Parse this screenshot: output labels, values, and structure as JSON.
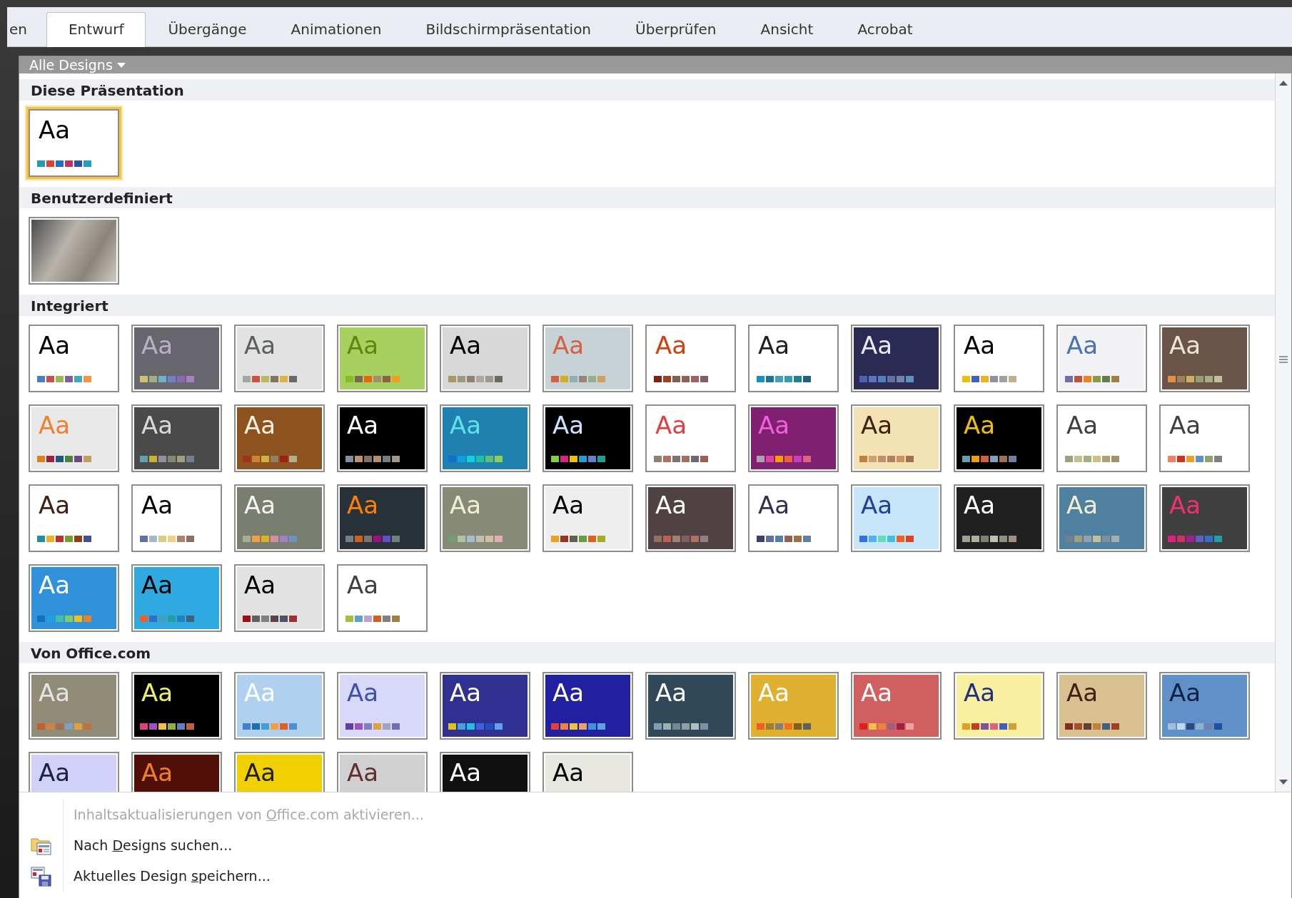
{
  "tabs": [
    {
      "label": "en",
      "selected": false
    },
    {
      "label": "Entwurf",
      "selected": true
    },
    {
      "label": "Übergänge",
      "selected": false
    },
    {
      "label": "Animationen",
      "selected": false
    },
    {
      "label": "Bildschirmpräsentation",
      "selected": false
    },
    {
      "label": "Überprüfen",
      "selected": false
    },
    {
      "label": "Ansicht",
      "selected": false
    },
    {
      "label": "Acrobat",
      "selected": false
    }
  ],
  "gallery": {
    "filter": "Alle Designs",
    "sections": [
      {
        "title": "Diese Präsentation",
        "thumbnails": [
          {
            "kind": "theme",
            "selected": true,
            "color": "#ffffff",
            "sample": {
              "label": "Aa",
              "color": "#000000"
            },
            "swatches": [
              {
                "color": "#1f9bb8"
              },
              {
                "color": "#e04030"
              },
              {
                "color": "#2070c0"
              },
              {
                "color": "#c03060"
              },
              {
                "color": "#3050a0"
              },
              {
                "color": "#20a0c0"
              }
            ]
          }
        ]
      },
      {
        "title": "Benutzerdefiniert",
        "thumbnails": [
          {
            "kind": "photo",
            "selected": false
          }
        ]
      },
      {
        "title": "Integriert",
        "thumbnails": [
          {
            "kind": "theme",
            "selected": false,
            "color": "#ffffff",
            "sample": {
              "label": "Aa",
              "color": "#000000"
            },
            "swatches": [
              {
                "color": "#4a7ec0"
              },
              {
                "color": "#c85050"
              },
              {
                "color": "#9ab850"
              },
              {
                "color": "#7e60a0"
              },
              {
                "color": "#40a8c4"
              },
              {
                "color": "#f69440"
              }
            ]
          },
          {
            "kind": "theme",
            "selected": false,
            "color": "#66666c",
            "sample": {
              "label": "Aa",
              "color": "#b8b0c8"
            },
            "swatches": [
              {
                "color": "#cfc070"
              },
              {
                "color": "#a0b080"
              },
              {
                "color": "#70b0c8"
              },
              {
                "color": "#7080c8"
              },
              {
                "color": "#8868b8"
              },
              {
                "color": "#a880c0"
              }
            ]
          },
          {
            "kind": "theme",
            "selected": false,
            "color": "#e2e2e2",
            "sample": {
              "label": "Aa",
              "color": "#5a6060"
            },
            "swatches": [
              {
                "color": "#a0a8a0"
              },
              {
                "color": "#d05040"
              },
              {
                "color": "#c0b860"
              },
              {
                "color": "#807858"
              },
              {
                "color": "#e0b040"
              },
              {
                "color": "#706868"
              }
            ]
          },
          {
            "kind": "theme",
            "selected": false,
            "color": "#a8d060",
            "sample": {
              "label": "Aa",
              "color": "#5c8a08"
            },
            "swatches": [
              {
                "color": "#80c020"
              },
              {
                "color": "#786850"
              },
              {
                "color": "#f06010"
              },
              {
                "color": "#a09070"
              },
              {
                "color": "#906040"
              },
              {
                "color": "#f0a020"
              }
            ]
          },
          {
            "kind": "theme",
            "selected": false,
            "color": "#d8d8d8",
            "sample": {
              "label": "Aa",
              "color": "#000000"
            },
            "swatches": [
              {
                "color": "#a89868"
              },
              {
                "color": "#a09880"
              },
              {
                "color": "#908070"
              },
              {
                "color": "#b0a898"
              },
              {
                "color": "#a09890"
              },
              {
                "color": "#706858"
              }
            ]
          },
          {
            "kind": "theme",
            "selected": false,
            "color": "#c6d2d6",
            "sample": {
              "label": "Aa",
              "color": "#d86040"
            },
            "swatches": [
              {
                "color": "#d06040"
              },
              {
                "color": "#d0b020"
              },
              {
                "color": "#90b0b0"
              },
              {
                "color": "#a08070"
              },
              {
                "color": "#90b090"
              },
              {
                "color": "#d0a060"
              }
            ]
          },
          {
            "kind": "theme",
            "selected": false,
            "color": "#ffffff",
            "sample": {
              "label": "Aa",
              "color": "#d04010"
            },
            "swatches": [
              {
                "color": "#802010"
              },
              {
                "color": "#a04020"
              },
              {
                "color": "#806050"
              },
              {
                "color": "#906050"
              },
              {
                "color": "#a06060"
              },
              {
                "color": "#806060"
              }
            ]
          },
          {
            "kind": "theme",
            "selected": false,
            "color": "#ffffff",
            "sample": {
              "label": "Aa",
              "color": "#202020"
            },
            "swatches": [
              {
                "color": "#1890c0"
              },
              {
                "color": "#2070a0"
              },
              {
                "color": "#40a0c0"
              },
              {
                "color": "#30a0b0"
              },
              {
                "color": "#208090"
              },
              {
                "color": "#206080"
              }
            ]
          },
          {
            "kind": "theme",
            "selected": false,
            "color": "#2a2a52",
            "sample": {
              "label": "Aa",
              "color": "#e8e8f8"
            },
            "swatches": [
              {
                "color": "#5060b0"
              },
              {
                "color": "#6070c0"
              },
              {
                "color": "#5080c0"
              },
              {
                "color": "#6070a0"
              },
              {
                "color": "#7080b0"
              },
              {
                "color": "#6090c0"
              }
            ]
          },
          {
            "kind": "theme",
            "selected": false,
            "color": "#ffffff",
            "sample": {
              "label": "Aa",
              "color": "#000000"
            },
            "swatches": [
              {
                "color": "#f0c000"
              },
              {
                "color": "#4060c0"
              },
              {
                "color": "#f0b020"
              },
              {
                "color": "#9090a0"
              },
              {
                "color": "#a0a0a0"
              },
              {
                "color": "#c0b090"
              }
            ]
          },
          {
            "kind": "theme",
            "selected": false,
            "color": "#f2f2f6",
            "sample": {
              "label": "Aa",
              "color": "#4a72b8"
            },
            "swatches": [
              {
                "color": "#7070a0"
              },
              {
                "color": "#c05040"
              },
              {
                "color": "#f08020"
              },
              {
                "color": "#80a040"
              },
              {
                "color": "#608050"
              },
              {
                "color": "#a08040"
              }
            ]
          },
          {
            "kind": "theme",
            "selected": false,
            "color": "#6a5448",
            "sample": {
              "label": "Aa",
              "color": "#ece4d4"
            },
            "swatches": [
              {
                "color": "#e09040"
              },
              {
                "color": "#a08060"
              },
              {
                "color": "#d0b060"
              },
              {
                "color": "#90a070"
              },
              {
                "color": "#a0b080"
              },
              {
                "color": "#c0c0a0"
              }
            ]
          },
          {
            "kind": "theme",
            "selected": false,
            "color": "#e8e8e8",
            "sample": {
              "label": "Aa",
              "color": "#f08030"
            },
            "swatches": [
              {
                "color": "#e08020"
              },
              {
                "color": "#a02040"
              },
              {
                "color": "#1a5a80"
              },
              {
                "color": "#4a8040"
              },
              {
                "color": "#704880"
              },
              {
                "color": "#c0a060"
              }
            ]
          },
          {
            "kind": "theme",
            "selected": false,
            "color": "#4a4a4a",
            "sample": {
              "label": "Aa",
              "color": "#d8d8d8"
            },
            "swatches": [
              {
                "color": "#60a0b0"
              },
              {
                "color": "#c8b030"
              },
              {
                "color": "#9090a0"
              },
              {
                "color": "#808870"
              },
              {
                "color": "#a0a080"
              },
              {
                "color": "#708090"
              }
            ]
          },
          {
            "kind": "theme",
            "selected": false,
            "color": "#8c5220",
            "sample": {
              "label": "Aa",
              "color": "#f8f0e0"
            },
            "swatches": [
              {
                "color": "#a03020"
              },
              {
                "color": "#d08030"
              },
              {
                "color": "#d0b040"
              },
              {
                "color": "#908060"
              },
              {
                "color": "#a02010"
              },
              {
                "color": "#b0b090"
              }
            ]
          },
          {
            "kind": "theme",
            "selected": false,
            "color": "#000000",
            "sample": {
              "label": "Aa",
              "color": "#ffffff"
            },
            "swatches": [
              {
                "color": "#8090a0"
              },
              {
                "color": "#c09070"
              },
              {
                "color": "#807068"
              },
              {
                "color": "#b09070"
              },
              {
                "color": "#708080"
              },
              {
                "color": "#a09880"
              }
            ]
          },
          {
            "kind": "theme",
            "selected": false,
            "color": "#2080b0",
            "sample": {
              "label": "Aa",
              "color": "#60e0e8"
            },
            "swatches": [
              {
                "color": "#1070d0"
              },
              {
                "color": "#10a0e0"
              },
              {
                "color": "#10d0e0"
              },
              {
                "color": "#20c0a0"
              },
              {
                "color": "#60c070"
              },
              {
                "color": "#90d050"
              }
            ]
          },
          {
            "kind": "theme",
            "selected": false,
            "color": "#000000",
            "sample": {
              "label": "Aa",
              "color": "#c8e4ff"
            },
            "swatches": [
              {
                "color": "#80d040"
              },
              {
                "color": "#e02080"
              },
              {
                "color": "#f0c000"
              },
              {
                "color": "#20a0d0"
              },
              {
                "color": "#6080d0"
              },
              {
                "color": "#20a090"
              }
            ]
          },
          {
            "kind": "theme",
            "selected": false,
            "color": "#ffffff",
            "sample": {
              "label": "Aa",
              "color": "#e04040"
            },
            "swatches": [
              {
                "color": "#908070"
              },
              {
                "color": "#b07060"
              },
              {
                "color": "#807070"
              },
              {
                "color": "#a07060"
              },
              {
                "color": "#706870"
              },
              {
                "color": "#a06050"
              }
            ]
          },
          {
            "kind": "theme",
            "selected": false,
            "color": "#802070",
            "sample": {
              "label": "Aa",
              "color": "#f060d8"
            },
            "swatches": [
              {
                "color": "#b0a0b0"
              },
              {
                "color": "#e040a0"
              },
              {
                "color": "#f0a000"
              },
              {
                "color": "#f06040"
              },
              {
                "color": "#c040c0"
              },
              {
                "color": "#e06080"
              }
            ]
          },
          {
            "kind": "theme",
            "selected": false,
            "color": "#f2e2b4",
            "sample": {
              "label": "Aa",
              "color": "#402010"
            },
            "swatches": [
              {
                "color": "#c08040"
              },
              {
                "color": "#d0a070"
              },
              {
                "color": "#c09070"
              },
              {
                "color": "#b08060"
              },
              {
                "color": "#d09060"
              },
              {
                "color": "#a07050"
              }
            ]
          },
          {
            "kind": "theme",
            "selected": false,
            "color": "#000000",
            "sample": {
              "label": "Aa",
              "color": "#f0c000"
            },
            "swatches": [
              {
                "color": "#60a0b0"
              },
              {
                "color": "#f0a000"
              },
              {
                "color": "#d06040"
              },
              {
                "color": "#80a0c0"
              },
              {
                "color": "#a07050"
              },
              {
                "color": "#7080a0"
              }
            ]
          },
          {
            "kind": "theme",
            "selected": false,
            "color": "#ffffff",
            "sample": {
              "label": "Aa",
              "color": "#404040"
            },
            "swatches": [
              {
                "color": "#a0a080"
              },
              {
                "color": "#c0c090"
              },
              {
                "color": "#a0b080"
              },
              {
                "color": "#d0c080"
              },
              {
                "color": "#b0a070"
              },
              {
                "color": "#a09070"
              }
            ]
          },
          {
            "kind": "theme",
            "selected": false,
            "color": "#ffffff",
            "sample": {
              "label": "Aa",
              "color": "#404040"
            },
            "swatches": [
              {
                "color": "#f08060"
              },
              {
                "color": "#d03020"
              },
              {
                "color": "#f0a020"
              },
              {
                "color": "#6090c0"
              },
              {
                "color": "#90a070"
              },
              {
                "color": "#808080"
              }
            ]
          },
          {
            "kind": "theme",
            "selected": false,
            "color": "#ffffff",
            "sample": {
              "label": "Aa",
              "color": "#402010"
            },
            "swatches": [
              {
                "color": "#2090a0"
              },
              {
                "color": "#f0b020"
              },
              {
                "color": "#c03030"
              },
              {
                "color": "#70a030"
              },
              {
                "color": "#904010"
              },
              {
                "color": "#405090"
              }
            ]
          },
          {
            "kind": "theme",
            "selected": false,
            "color": "#ffffff",
            "sample": {
              "label": "Aa",
              "color": "#000000"
            },
            "swatches": [
              {
                "color": "#6070a0"
              },
              {
                "color": "#a0b8d0"
              },
              {
                "color": "#d0d080"
              },
              {
                "color": "#f0d080"
              },
              {
                "color": "#b08070"
              },
              {
                "color": "#907060"
              }
            ]
          },
          {
            "kind": "theme",
            "selected": false,
            "color": "#7a7e70",
            "sample": {
              "label": "Aa",
              "color": "#f4f4f4"
            },
            "swatches": [
              {
                "color": "#a0b090"
              },
              {
                "color": "#f0a040"
              },
              {
                "color": "#e0b020"
              },
              {
                "color": "#d090a0"
              },
              {
                "color": "#a080c0"
              },
              {
                "color": "#7090c0"
              }
            ]
          },
          {
            "kind": "theme",
            "selected": false,
            "color": "#283038",
            "sample": {
              "label": "Aa",
              "color": "#ff8000"
            },
            "swatches": [
              {
                "color": "#708090"
              },
              {
                "color": "#d06020"
              },
              {
                "color": "#807070"
              },
              {
                "color": "#a01080"
              },
              {
                "color": "#6050d0"
              },
              {
                "color": "#708080"
              }
            ]
          },
          {
            "kind": "theme",
            "selected": false,
            "color": "#888a78",
            "sample": {
              "label": "Aa",
              "color": "#f0f0d0"
            },
            "swatches": [
              {
                "color": "#70a070"
              },
              {
                "color": "#b0c0a0"
              },
              {
                "color": "#a0c0d0"
              },
              {
                "color": "#c0c0b0"
              },
              {
                "color": "#d0c0a0"
              },
              {
                "color": "#e0b0b0"
              }
            ]
          },
          {
            "kind": "theme",
            "selected": false,
            "color": "#eeeeee",
            "sample": {
              "label": "Aa",
              "color": "#000000"
            },
            "swatches": [
              {
                "color": "#f0a020"
              },
              {
                "color": "#a03020"
              },
              {
                "color": "#606050"
              },
              {
                "color": "#60a040"
              },
              {
                "color": "#e06020"
              },
              {
                "color": "#a0b020"
              }
            ]
          },
          {
            "kind": "theme",
            "selected": false,
            "color": "#504242",
            "sample": {
              "label": "Aa",
              "color": "#ffffff"
            },
            "swatches": [
              {
                "color": "#907060"
              },
              {
                "color": "#c06050"
              },
              {
                "color": "#a08070"
              },
              {
                "color": "#806060"
              },
              {
                "color": "#b07060"
              },
              {
                "color": "#908080"
              }
            ]
          },
          {
            "kind": "theme",
            "selected": false,
            "color": "#ffffff",
            "sample": {
              "label": "Aa",
              "color": "#303050"
            },
            "swatches": [
              {
                "color": "#404070"
              },
              {
                "color": "#6070a0"
              },
              {
                "color": "#5080b0"
              },
              {
                "color": "#906050"
              },
              {
                "color": "#a07040"
              },
              {
                "color": "#6080a0"
              }
            ]
          },
          {
            "kind": "theme",
            "selected": false,
            "color": "#c8e4f8",
            "sample": {
              "label": "Aa",
              "color": "#2040a0"
            },
            "swatches": [
              {
                "color": "#3070e0"
              },
              {
                "color": "#50b0f0"
              },
              {
                "color": "#60e0b0"
              },
              {
                "color": "#40c0e0"
              },
              {
                "color": "#f06020"
              },
              {
                "color": "#e04020"
              }
            ]
          },
          {
            "kind": "theme",
            "selected": false,
            "color": "#202020",
            "sample": {
              "label": "Aa",
              "color": "#ffffff"
            },
            "swatches": [
              {
                "color": "#a0a090"
              },
              {
                "color": "#b0b0a0"
              },
              {
                "color": "#808070"
              },
              {
                "color": "#c0c0b0"
              },
              {
                "color": "#909080"
              },
              {
                "color": "#a09080"
              }
            ]
          },
          {
            "kind": "theme",
            "selected": false,
            "color": "#5080a0",
            "sample": {
              "label": "Aa",
              "color": "#f0f0d0"
            },
            "swatches": [
              {
                "color": "#708090"
              },
              {
                "color": "#a0a070"
              },
              {
                "color": "#90a0b0"
              },
              {
                "color": "#c0c090"
              },
              {
                "color": "#8090a0"
              },
              {
                "color": "#a0b0b0"
              }
            ]
          },
          {
            "kind": "theme",
            "selected": false,
            "color": "#404040",
            "sample": {
              "label": "Aa",
              "color": "#f03070"
            },
            "swatches": [
              {
                "color": "#e02080"
              },
              {
                "color": "#d03060"
              },
              {
                "color": "#a02090"
              },
              {
                "color": "#6060c0"
              },
              {
                "color": "#3070d0"
              },
              {
                "color": "#20a0a0"
              }
            ]
          },
          {
            "kind": "theme",
            "selected": false,
            "color": "#3090d8",
            "sample": {
              "label": "Aa",
              "color": "#ffffff"
            },
            "swatches": [
              {
                "color": "#1070c0"
              },
              {
                "color": "#20a0e0"
              },
              {
                "color": "#40c0a0"
              },
              {
                "color": "#80d060"
              },
              {
                "color": "#f0c020"
              },
              {
                "color": "#f08020"
              }
            ]
          },
          {
            "kind": "theme",
            "selected": false,
            "color": "#30a8e0",
            "sample": {
              "label": "Aa",
              "color": "#000000"
            },
            "swatches": [
              {
                "color": "#f06020"
              },
              {
                "color": "#3070c0"
              },
              {
                "color": "#40a0c0"
              },
              {
                "color": "#20a0a0"
              },
              {
                "color": "#2080c0"
              },
              {
                "color": "#406080"
              }
            ]
          },
          {
            "kind": "theme",
            "selected": false,
            "color": "#e2e2e2",
            "sample": {
              "label": "Aa",
              "color": "#000000"
            },
            "swatches": [
              {
                "color": "#a01010"
              },
              {
                "color": "#606060"
              },
              {
                "color": "#808080"
              },
              {
                "color": "#604040"
              },
              {
                "color": "#505060"
              },
              {
                "color": "#a03030"
              }
            ]
          },
          {
            "kind": "theme",
            "selected": false,
            "color": "#ffffff",
            "sample": {
              "label": "Aa",
              "color": "#404040"
            },
            "swatches": [
              {
                "color": "#a0c040"
              },
              {
                "color": "#60a0d0"
              },
              {
                "color": "#c0a0d0"
              },
              {
                "color": "#d06020"
              },
              {
                "color": "#808080"
              },
              {
                "color": "#a08040"
              }
            ]
          }
        ]
      },
      {
        "title": "Von Office.com",
        "thumbnails": [
          {
            "kind": "theme",
            "selected": false,
            "color": "#908c78",
            "sample": {
              "label": "Aa",
              "color": "#e4e4e4"
            },
            "swatches": [
              {
                "color": "#c06030"
              },
              {
                "color": "#d08040"
              },
              {
                "color": "#a07050"
              },
              {
                "color": "#80a0c0"
              },
              {
                "color": "#e0a040"
              },
              {
                "color": "#c07040"
              }
            ]
          },
          {
            "kind": "theme",
            "selected": false,
            "color": "#000000",
            "sample": {
              "label": "Aa",
              "color": "#f0f060"
            },
            "swatches": [
              {
                "color": "#e04080"
              },
              {
                "color": "#a050c0"
              },
              {
                "color": "#f0c040"
              },
              {
                "color": "#90b040"
              },
              {
                "color": "#6080c0"
              },
              {
                "color": "#c06040"
              }
            ]
          },
          {
            "kind": "theme",
            "selected": false,
            "color": "#b0d0f0",
            "sample": {
              "label": "Aa",
              "color": "#ffffff"
            },
            "swatches": [
              {
                "color": "#4080d0"
              },
              {
                "color": "#2070b0"
              },
              {
                "color": "#40a0d0"
              },
              {
                "color": "#f0a040"
              },
              {
                "color": "#e06020"
              },
              {
                "color": "#5090d0"
              }
            ]
          },
          {
            "kind": "theme",
            "selected": false,
            "color": "#d8d8f8",
            "sample": {
              "label": "Aa",
              "color": "#4050b0"
            },
            "swatches": [
              {
                "color": "#6040a0"
              },
              {
                "color": "#a050c0"
              },
              {
                "color": "#8080c0"
              },
              {
                "color": "#e0a040"
              },
              {
                "color": "#a0a0c0"
              },
              {
                "color": "#7070b0"
              }
            ]
          },
          {
            "kind": "theme",
            "selected": false,
            "color": "#303090",
            "sample": {
              "label": "Aa",
              "color": "#ffffff"
            },
            "swatches": [
              {
                "color": "#e0c020"
              },
              {
                "color": "#40a0e0"
              },
              {
                "color": "#20c0e0"
              },
              {
                "color": "#4060e0"
              },
              {
                "color": "#2050c0"
              },
              {
                "color": "#60a0f0"
              }
            ]
          },
          {
            "kind": "theme",
            "selected": false,
            "color": "#2020a0",
            "sample": {
              "label": "Aa",
              "color": "#ffffff"
            },
            "swatches": [
              {
                "color": "#e04040"
              },
              {
                "color": "#f08040"
              },
              {
                "color": "#f0c040"
              },
              {
                "color": "#f0a060"
              },
              {
                "color": "#4090e0"
              },
              {
                "color": "#60a0e0"
              }
            ]
          },
          {
            "kind": "theme",
            "selected": false,
            "color": "#304858",
            "sample": {
              "label": "Aa",
              "color": "#ffffff"
            },
            "swatches": [
              {
                "color": "#80a0b0"
              },
              {
                "color": "#a0b0b0"
              },
              {
                "color": "#708890"
              },
              {
                "color": "#90a0a0"
              },
              {
                "color": "#b0c0c0"
              },
              {
                "color": "#8090a0"
              }
            ]
          },
          {
            "kind": "theme",
            "selected": false,
            "color": "#e0b030",
            "sample": {
              "label": "Aa",
              "color": "#ffffff"
            },
            "swatches": [
              {
                "color": "#f06020"
              },
              {
                "color": "#a08030"
              },
              {
                "color": "#808080"
              },
              {
                "color": "#f07020"
              },
              {
                "color": "#806020"
              },
              {
                "color": "#606060"
              }
            ]
          },
          {
            "kind": "theme",
            "selected": false,
            "color": "#d06060",
            "sample": {
              "label": "Aa",
              "color": "#ffffff"
            },
            "swatches": [
              {
                "color": "#e02020"
              },
              {
                "color": "#f0c040"
              },
              {
                "color": "#f08040"
              },
              {
                "color": "#a06080"
              },
              {
                "color": "#a02040"
              },
              {
                "color": "#f0a0a0"
              }
            ]
          },
          {
            "kind": "theme",
            "selected": false,
            "color": "#f8f0a0",
            "sample": {
              "label": "Aa",
              "color": "#203080"
            },
            "swatches": [
              {
                "color": "#e0a020"
              },
              {
                "color": "#c04020"
              },
              {
                "color": "#8050a0"
              },
              {
                "color": "#e06080"
              },
              {
                "color": "#4060c0"
              },
              {
                "color": "#d0a040"
              }
            ]
          },
          {
            "kind": "theme",
            "selected": false,
            "color": "#d8c090",
            "sample": {
              "label": "Aa",
              "color": "#402010"
            },
            "swatches": [
              {
                "color": "#803020"
              },
              {
                "color": "#a05030"
              },
              {
                "color": "#604030"
              },
              {
                "color": "#c08040"
              },
              {
                "color": "#406080"
              },
              {
                "color": "#a04020"
              }
            ]
          },
          {
            "kind": "theme",
            "selected": false,
            "color": "#6090c8",
            "sample": {
              "label": "Aa",
              "color": "#102040"
            },
            "swatches": [
              {
                "color": "#a0c0e0"
              },
              {
                "color": "#c0d8f0"
              },
              {
                "color": "#304880"
              },
              {
                "color": "#90b0d0"
              },
              {
                "color": "#7080b0"
              },
              {
                "color": "#2050a0"
              }
            ]
          },
          {
            "kind": "theme",
            "selected": false,
            "color": "#d0d0f8",
            "sample": {
              "label": "Aa",
              "color": "#202040"
            }
          },
          {
            "kind": "theme",
            "selected": false,
            "color": "#501008",
            "sample": {
              "label": "Aa",
              "color": "#f08020"
            }
          },
          {
            "kind": "theme",
            "selected": false,
            "color": "#f0d000",
            "sample": {
              "label": "Aa",
              "color": "#202020"
            }
          },
          {
            "kind": "theme",
            "selected": false,
            "color": "#d0d0d0",
            "sample": {
              "label": "Aa",
              "color": "#603030"
            }
          },
          {
            "kind": "theme",
            "selected": false,
            "color": "#101010",
            "sample": {
              "label": "Aa",
              "color": "#ffffff"
            }
          },
          {
            "kind": "theme",
            "selected": false,
            "color": "#e8e8e0",
            "sample": {
              "label": "Aa",
              "color": "#000000"
            }
          }
        ]
      }
    ]
  },
  "menu": [
    {
      "kind": "plain",
      "label_before": "Inhaltsaktualisierungen von ",
      "access_key": "O",
      "label_after": "ffice.com aktivieren...",
      "disabled": true
    },
    {
      "kind": "browse",
      "label_before": "Nach ",
      "access_key": "D",
      "label_after": "esigns suchen...",
      "disabled": false
    },
    {
      "kind": "save",
      "label_before": "Aktuelles Design ",
      "access_key": "s",
      "label_after": "peichern...",
      "disabled": false
    }
  ]
}
